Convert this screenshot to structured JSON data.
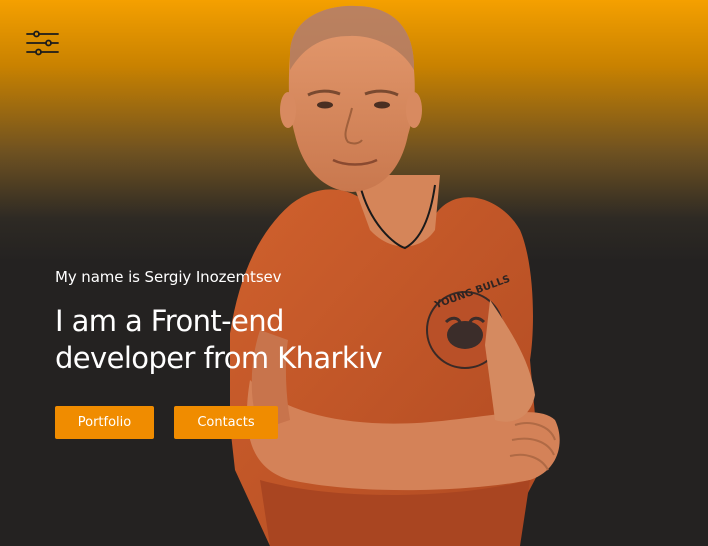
{
  "header": {
    "settings_icon": "sliders-icon"
  },
  "hero": {
    "intro": "My name is Sergiy Inozemtsev",
    "headline_line1": "I am a Front-end",
    "headline_line2": "developer from Kharkiv",
    "tshirt_text": "YOUNG BULLS",
    "buttons": {
      "portfolio": "Portfolio",
      "contacts": "Contacts"
    }
  },
  "colors": {
    "accent": "#f08c00",
    "gradient_top": "#f5a000",
    "background": "#242221",
    "text": "#ffffff",
    "shirt": "#cc5a2a"
  }
}
